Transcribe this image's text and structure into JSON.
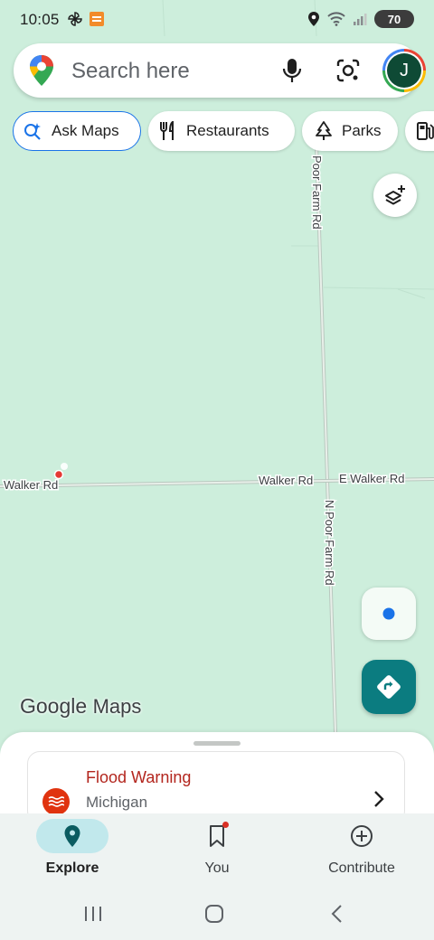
{
  "status_bar": {
    "time": "10:05",
    "battery": "70",
    "icons": [
      "pinwheel-icon",
      "app-notification-icon",
      "location-icon",
      "wifi-icon",
      "signal-icon",
      "battery-icon"
    ]
  },
  "search": {
    "placeholder": "Search here",
    "avatar_initial": "J"
  },
  "chips": [
    {
      "label": "Ask Maps",
      "icon": "sparkle-search-icon"
    },
    {
      "label": "Restaurants",
      "icon": "fork-knife-icon"
    },
    {
      "label": "Parks",
      "icon": "tree-icon"
    },
    {
      "label": "",
      "icon": "gas-pump-icon"
    }
  ],
  "map": {
    "roads": [
      {
        "label": "Poor Farm Rd"
      },
      {
        "label": "Walker Rd"
      },
      {
        "label": "Walker Rd"
      },
      {
        "label": "E Walker Rd"
      },
      {
        "label": "N Poor Farm Rd"
      }
    ],
    "attribution_google": "Google",
    "attribution_maps": "Maps"
  },
  "alert": {
    "title": "Flood Warning",
    "region": "Michigan"
  },
  "bottom_nav": [
    {
      "label": "Explore",
      "icon": "explore-pin-icon",
      "active": true
    },
    {
      "label": "You",
      "icon": "bookmark-icon",
      "active": false
    },
    {
      "label": "Contribute",
      "icon": "add-circle-icon",
      "active": false
    }
  ],
  "colors": {
    "map_bg": "#cdeedc",
    "accent_teal": "#0b7c80",
    "alert_red": "#b3261e",
    "chip_outline_blue": "#1a73e8"
  }
}
